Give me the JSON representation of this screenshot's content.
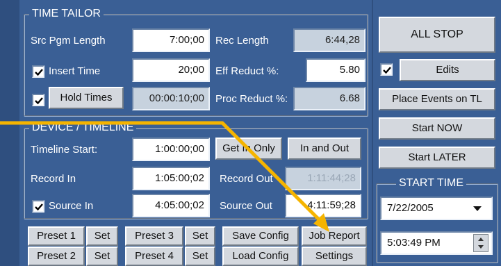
{
  "time_tailor": {
    "title": "TIME TAILOR",
    "src_pgm_length_label": "Src Pgm Length",
    "src_pgm_length_value": "7:00;00",
    "rec_length_label": "Rec Length",
    "rec_length_value": "6:44,28",
    "insert_time_label": "Insert Time",
    "insert_time_checked": true,
    "insert_time_value": "20;00",
    "eff_reduct_label": "Eff Reduct %:",
    "eff_reduct_value": "5.80",
    "hold_times_checked": true,
    "hold_times_label": "Hold Times",
    "hold_times_value": "00:00:10;00",
    "proc_reduct_label": "Proc Reduct %:",
    "proc_reduct_value": "6.68"
  },
  "device_timeline": {
    "title": "DEVICE / TIMELINE",
    "timeline_start_label": "Timeline Start:",
    "timeline_start_value": "1:00:00;00",
    "get_in_only_label": "Get In Only",
    "in_and_out_label": "In and Out",
    "record_in_label": "Record In",
    "record_in_value": "1:05:00;02",
    "record_out_label": "Record Out",
    "record_out_value": "1:11:44;28",
    "source_in_checked": true,
    "source_in_label": "Source In",
    "source_in_value": "4:05:00;02",
    "source_out_label": "Source Out",
    "source_out_value": "4:11:59;28"
  },
  "presets": {
    "preset1": "Preset 1",
    "preset2": "Preset 2",
    "preset3": "Preset 3",
    "preset4": "Preset 4",
    "set": "Set",
    "save_config": "Save Config",
    "load_config": "Load Config",
    "job_report": "Job Report",
    "settings": "Settings"
  },
  "right_panel": {
    "all_stop": "ALL STOP",
    "edits_checked": true,
    "edits": "Edits",
    "place_events": "Place Events on TL",
    "start_now": "Start NOW",
    "start_later": "Start LATER",
    "start_time_title": "START TIME",
    "date_value": "7/22/2005",
    "time_value": "5:03:49 PM"
  },
  "annotation": {
    "color": "#f5b400"
  }
}
